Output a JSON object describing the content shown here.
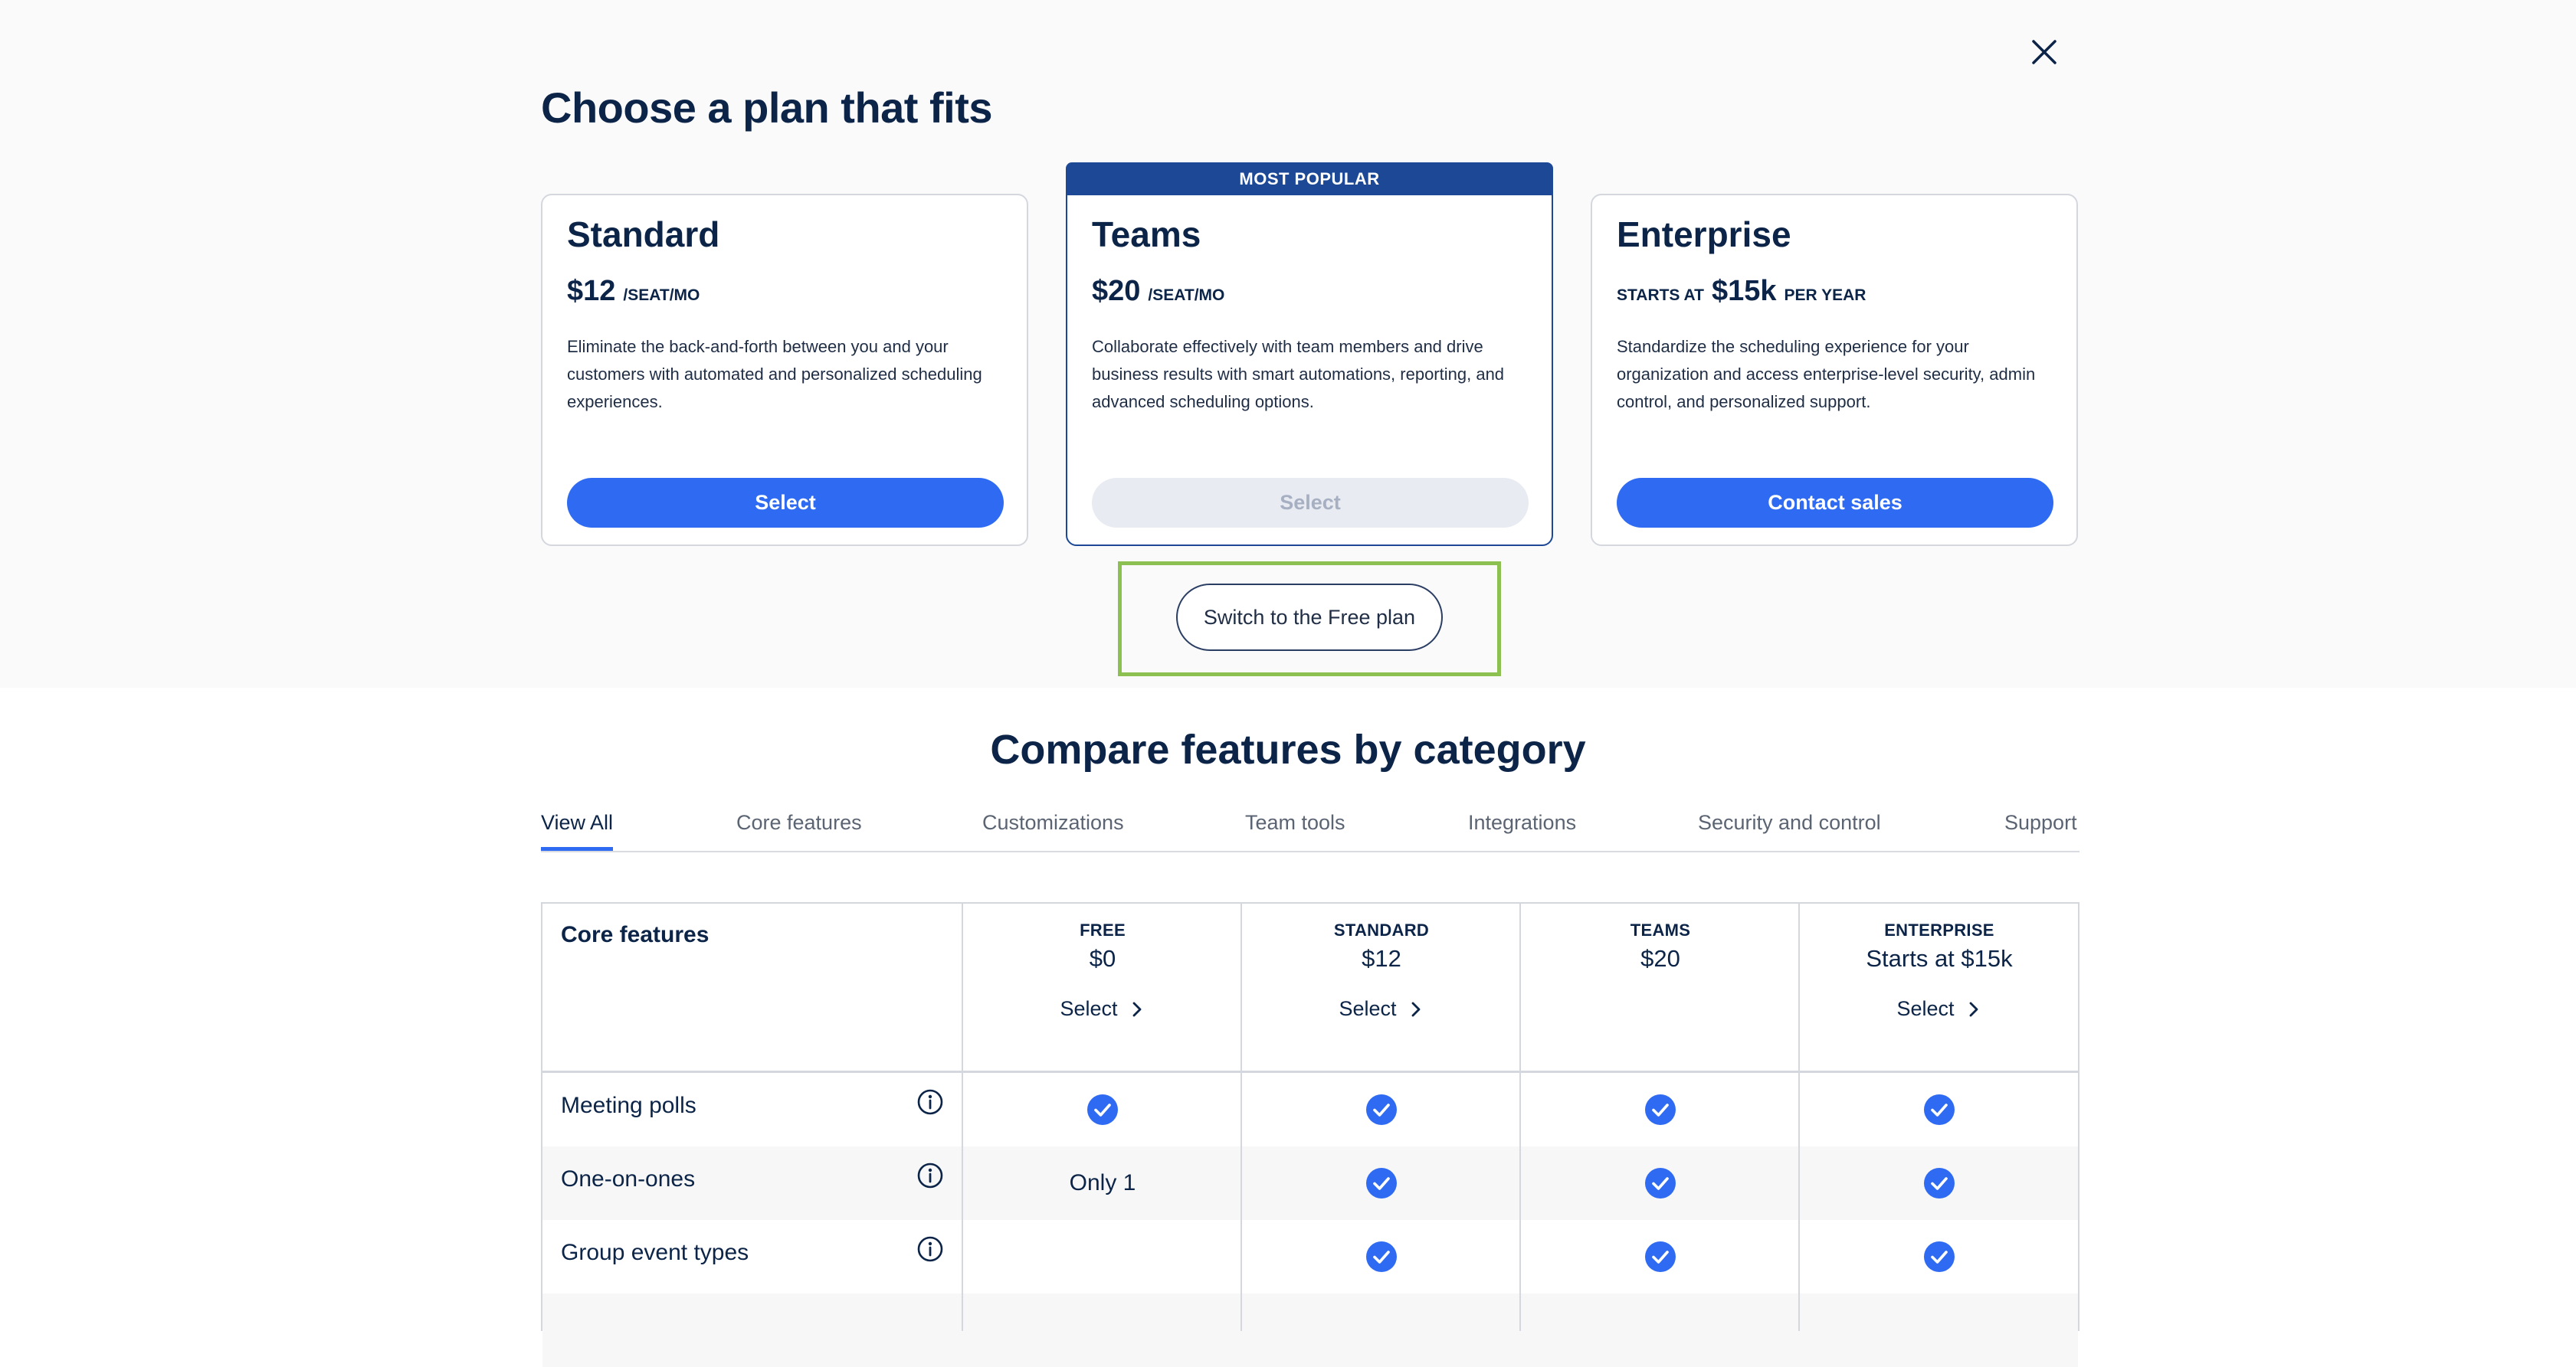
{
  "modal": {
    "title": "Choose a plan that fits",
    "close_icon": "close-icon"
  },
  "plans": [
    {
      "name": "Standard",
      "price": "$12",
      "price_unit": "/SEAT/MO",
      "description": "Eliminate the back-and-forth between you and your customers with automated and personalized scheduling experiences.",
      "button_label": "Select",
      "button_state": "enabled"
    },
    {
      "badge": "MOST POPULAR",
      "name": "Teams",
      "price": "$20",
      "price_unit": "/SEAT/MO",
      "description": "Collaborate effectively with team members and drive business results with smart automations, reporting, and advanced scheduling options.",
      "button_label": "Select",
      "button_state": "disabled"
    },
    {
      "name": "Enterprise",
      "price_prefix": "STARTS AT",
      "price": "$15k",
      "price_unit": "PER YEAR",
      "description": "Standardize the scheduling experience for your organization and access enterprise-level security, admin control, and personalized support.",
      "button_label": "Contact sales",
      "button_state": "enabled"
    }
  ],
  "free_plan_button": "Switch to the Free plan",
  "compare": {
    "title": "Compare features by category",
    "tabs": [
      "View All",
      "Core features",
      "Customizations",
      "Team tools",
      "Integrations",
      "Security and control",
      "Support"
    ],
    "active_tab": "View All",
    "table": {
      "category": "Core features",
      "columns": [
        {
          "name": "FREE",
          "price": "$0",
          "select": "Select"
        },
        {
          "name": "STANDARD",
          "price": "$12",
          "select": "Select"
        },
        {
          "name": "TEAMS",
          "price": "$20",
          "select": ""
        },
        {
          "name": "ENTERPRISE",
          "price": "Starts at $15k",
          "select": "Select"
        }
      ],
      "rows": [
        {
          "feature": "Meeting polls",
          "values": [
            "check",
            "check",
            "check",
            "check"
          ]
        },
        {
          "feature": "One-on-ones",
          "values": [
            "Only 1",
            "check",
            "check",
            "check"
          ]
        },
        {
          "feature": "Group event types",
          "values": [
            "",
            "check",
            "check",
            "check"
          ]
        }
      ]
    }
  },
  "colors": {
    "primary": "#2f6bf2",
    "navy": "#0b2447",
    "banner": "#1c4896",
    "highlight": "#8cc152",
    "disabled_bg": "#e8ebf1",
    "disabled_text": "#a6b0c2"
  }
}
